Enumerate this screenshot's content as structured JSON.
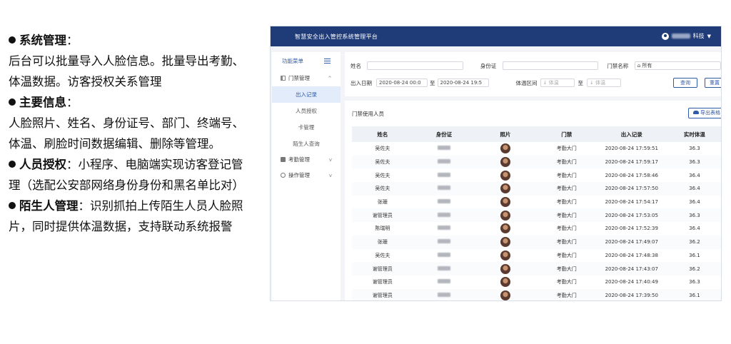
{
  "description": {
    "lines": [
      {
        "bullet": true,
        "bold": "系统管理",
        "text": "："
      },
      {
        "bullet": false,
        "bold": "",
        "text": "后台可以批量导入人脸信息。批量导出考勤、"
      },
      {
        "bullet": false,
        "bold": "",
        "text": "体温数据。访客授权关系管理"
      },
      {
        "bullet": true,
        "bold": "主要信息",
        "text": "："
      },
      {
        "bullet": false,
        "bold": "",
        "text": "人脸照片、姓名、身份证号、部门、终端号、"
      },
      {
        "bullet": false,
        "bold": "",
        "text": "体温、刷脸时间数据编辑、删除等管理。"
      },
      {
        "bullet": true,
        "bold": "人员授权",
        "text": "：小程序、电脑端实现访客登记管"
      },
      {
        "bullet": false,
        "bold": "",
        "text": "理（选配公安部网络身份身份和黑名单比对）"
      },
      {
        "bullet": true,
        "bold": "陌生人管理",
        "text": "：识别抓拍上传陌生人员人脸照"
      },
      {
        "bullet": false,
        "bold": "",
        "text": "片，同时提供体温数据，支持联动系统报警"
      }
    ]
  },
  "app": {
    "title": "智慧安全出入管控系统管理平台",
    "user_suffix": "科技",
    "user_caret": "▼",
    "colors": {
      "header": "#1f3c78",
      "accent": "#2f5aa8"
    },
    "sidebar": {
      "header": "功能菜单",
      "groups": [
        {
          "label": "门禁管理",
          "icon": "grid-icon",
          "chevron": "^",
          "items": [
            "出入记录",
            "人员授权",
            "卡管理",
            "陌生人查询"
          ],
          "active": "出入记录"
        },
        {
          "label": "考勤管理",
          "icon": "book-icon",
          "chevron": "v"
        },
        {
          "label": "操作管理",
          "icon": "gear-icon",
          "chevron": "v"
        }
      ]
    },
    "filters": {
      "name_label": "姓名",
      "id_label": "身份证",
      "gate_label": "门禁名称",
      "gate_value": "所有",
      "date_label": "出入日期",
      "date_from": "2020-08-24 00:0",
      "date_sep": "至",
      "date_to": "2020-08-24 19:5",
      "temp_label": "体温区间",
      "temp_from_ph": "体温",
      "temp_sep": "至",
      "temp_to_ph": "体温",
      "query_btn": "查询",
      "reset_btn": "重置"
    },
    "section_title": "门禁使用人员",
    "export_btn": "导出表格",
    "columns": [
      "姓名",
      "身份证",
      "照片",
      "门禁",
      "出入记录",
      "实时体温"
    ],
    "rows": [
      {
        "name": "吴佐夫",
        "gate": "考勤大门",
        "time": "2020-08-24 17:59:51",
        "temp": "36.3"
      },
      {
        "name": "吴佐夫",
        "gate": "考勤大门",
        "time": "2020-08-24 17:59:17",
        "temp": "36.3"
      },
      {
        "name": "吴佐夫",
        "gate": "考勤大门",
        "time": "2020-08-24 17:58:46",
        "temp": "36.4"
      },
      {
        "name": "吴佐夫",
        "gate": "考勤大门",
        "time": "2020-08-24 17:57:50",
        "temp": "36.4"
      },
      {
        "name": "张珊",
        "gate": "考勤大门",
        "time": "2020-08-24 17:54:17",
        "temp": "36.4"
      },
      {
        "name": "谢管理员",
        "gate": "考勤大门",
        "time": "2020-08-24 17:53:05",
        "temp": "36.3"
      },
      {
        "name": "陈瑞明",
        "gate": "考勤大门",
        "time": "2020-08-24 17:52:39",
        "temp": "36.4"
      },
      {
        "name": "张珊",
        "gate": "考勤大门",
        "time": "2020-08-24 17:49:07",
        "temp": "36.2"
      },
      {
        "name": "吴佐夫",
        "gate": "考勤大门",
        "time": "2020-08-24 17:48:38",
        "temp": "36.1"
      },
      {
        "name": "谢管理员",
        "gate": "考勤大门",
        "time": "2020-08-24 17:43:07",
        "temp": "36.2"
      },
      {
        "name": "谢管理员",
        "gate": "考勤大门",
        "time": "2020-08-24 17:40:49",
        "temp": "36.3"
      },
      {
        "name": "谢管理员",
        "gate": "考勤大门",
        "time": "2020-08-24 17:39:50",
        "temp": "36.1"
      }
    ]
  }
}
